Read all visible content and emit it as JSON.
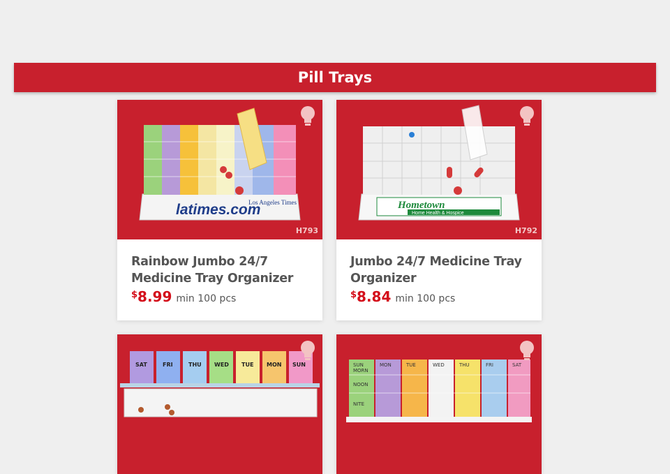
{
  "header": {
    "title": "Pill Trays"
  },
  "products": [
    {
      "title": "Rainbow Jumbo 24/7 Medicine Tray Organizer",
      "currency": "$",
      "price": "8.99",
      "min_qty": "min 100 pcs",
      "code": "H793",
      "imprint_top": "Los Angeles Times",
      "imprint_main": "latimes.com"
    },
    {
      "title": "Jumbo 24/7 Medicine Tray Organizer",
      "currency": "$",
      "price": "8.84",
      "min_qty": "min 100 pcs",
      "code": "H792",
      "imprint_main": "Hometown",
      "imprint_sub": "Home Health & Hospice"
    },
    {
      "lid_days": [
        "SAT",
        "FRI",
        "THU",
        "WED",
        "TUE",
        "MON",
        "SUN"
      ]
    },
    {
      "lid_days": [
        "SUN",
        "MON",
        "TUE",
        "WED",
        "THU",
        "FRI",
        "SAT"
      ],
      "row_labels": [
        "MORN",
        "NOON",
        "NITE"
      ]
    }
  ],
  "colors": {
    "brand_red": "#c8202d",
    "price_red": "#d40f1b"
  },
  "icons": {
    "idea": "lightbulb-icon"
  }
}
